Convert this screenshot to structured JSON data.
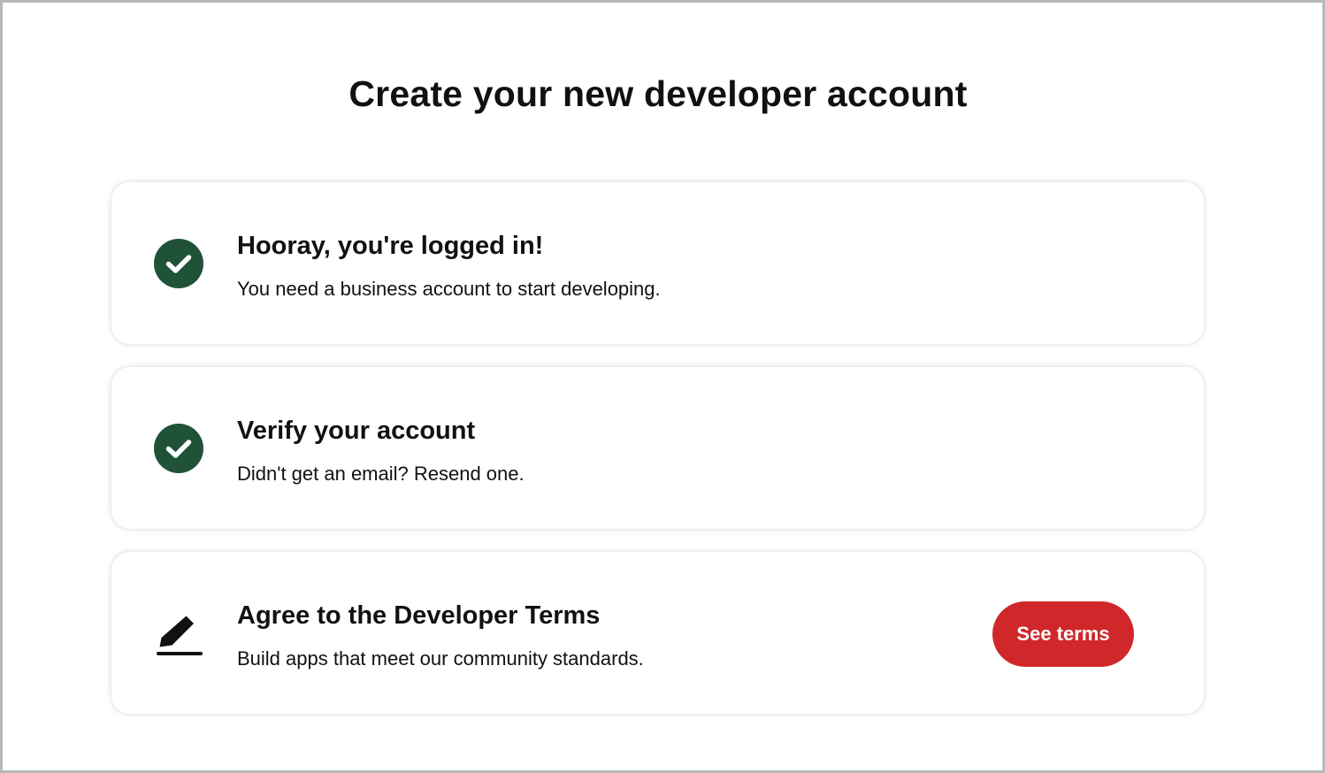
{
  "page": {
    "title": "Create your new developer account"
  },
  "steps": [
    {
      "icon": "check-circle-icon",
      "status": "complete",
      "heading": "Hooray, you're logged in!",
      "description": "You need a business account to start developing."
    },
    {
      "icon": "check-circle-icon",
      "status": "complete",
      "heading": "Verify your account",
      "description": "Didn't get an email? Resend one."
    },
    {
      "icon": "pen-icon",
      "status": "pending",
      "heading": "Agree to the Developer Terms",
      "description": "Build apps that meet our community standards.",
      "button_label": "See terms"
    }
  ],
  "colors": {
    "check_green": "#1f5236",
    "button_red": "#d0282a",
    "text": "#111111"
  }
}
